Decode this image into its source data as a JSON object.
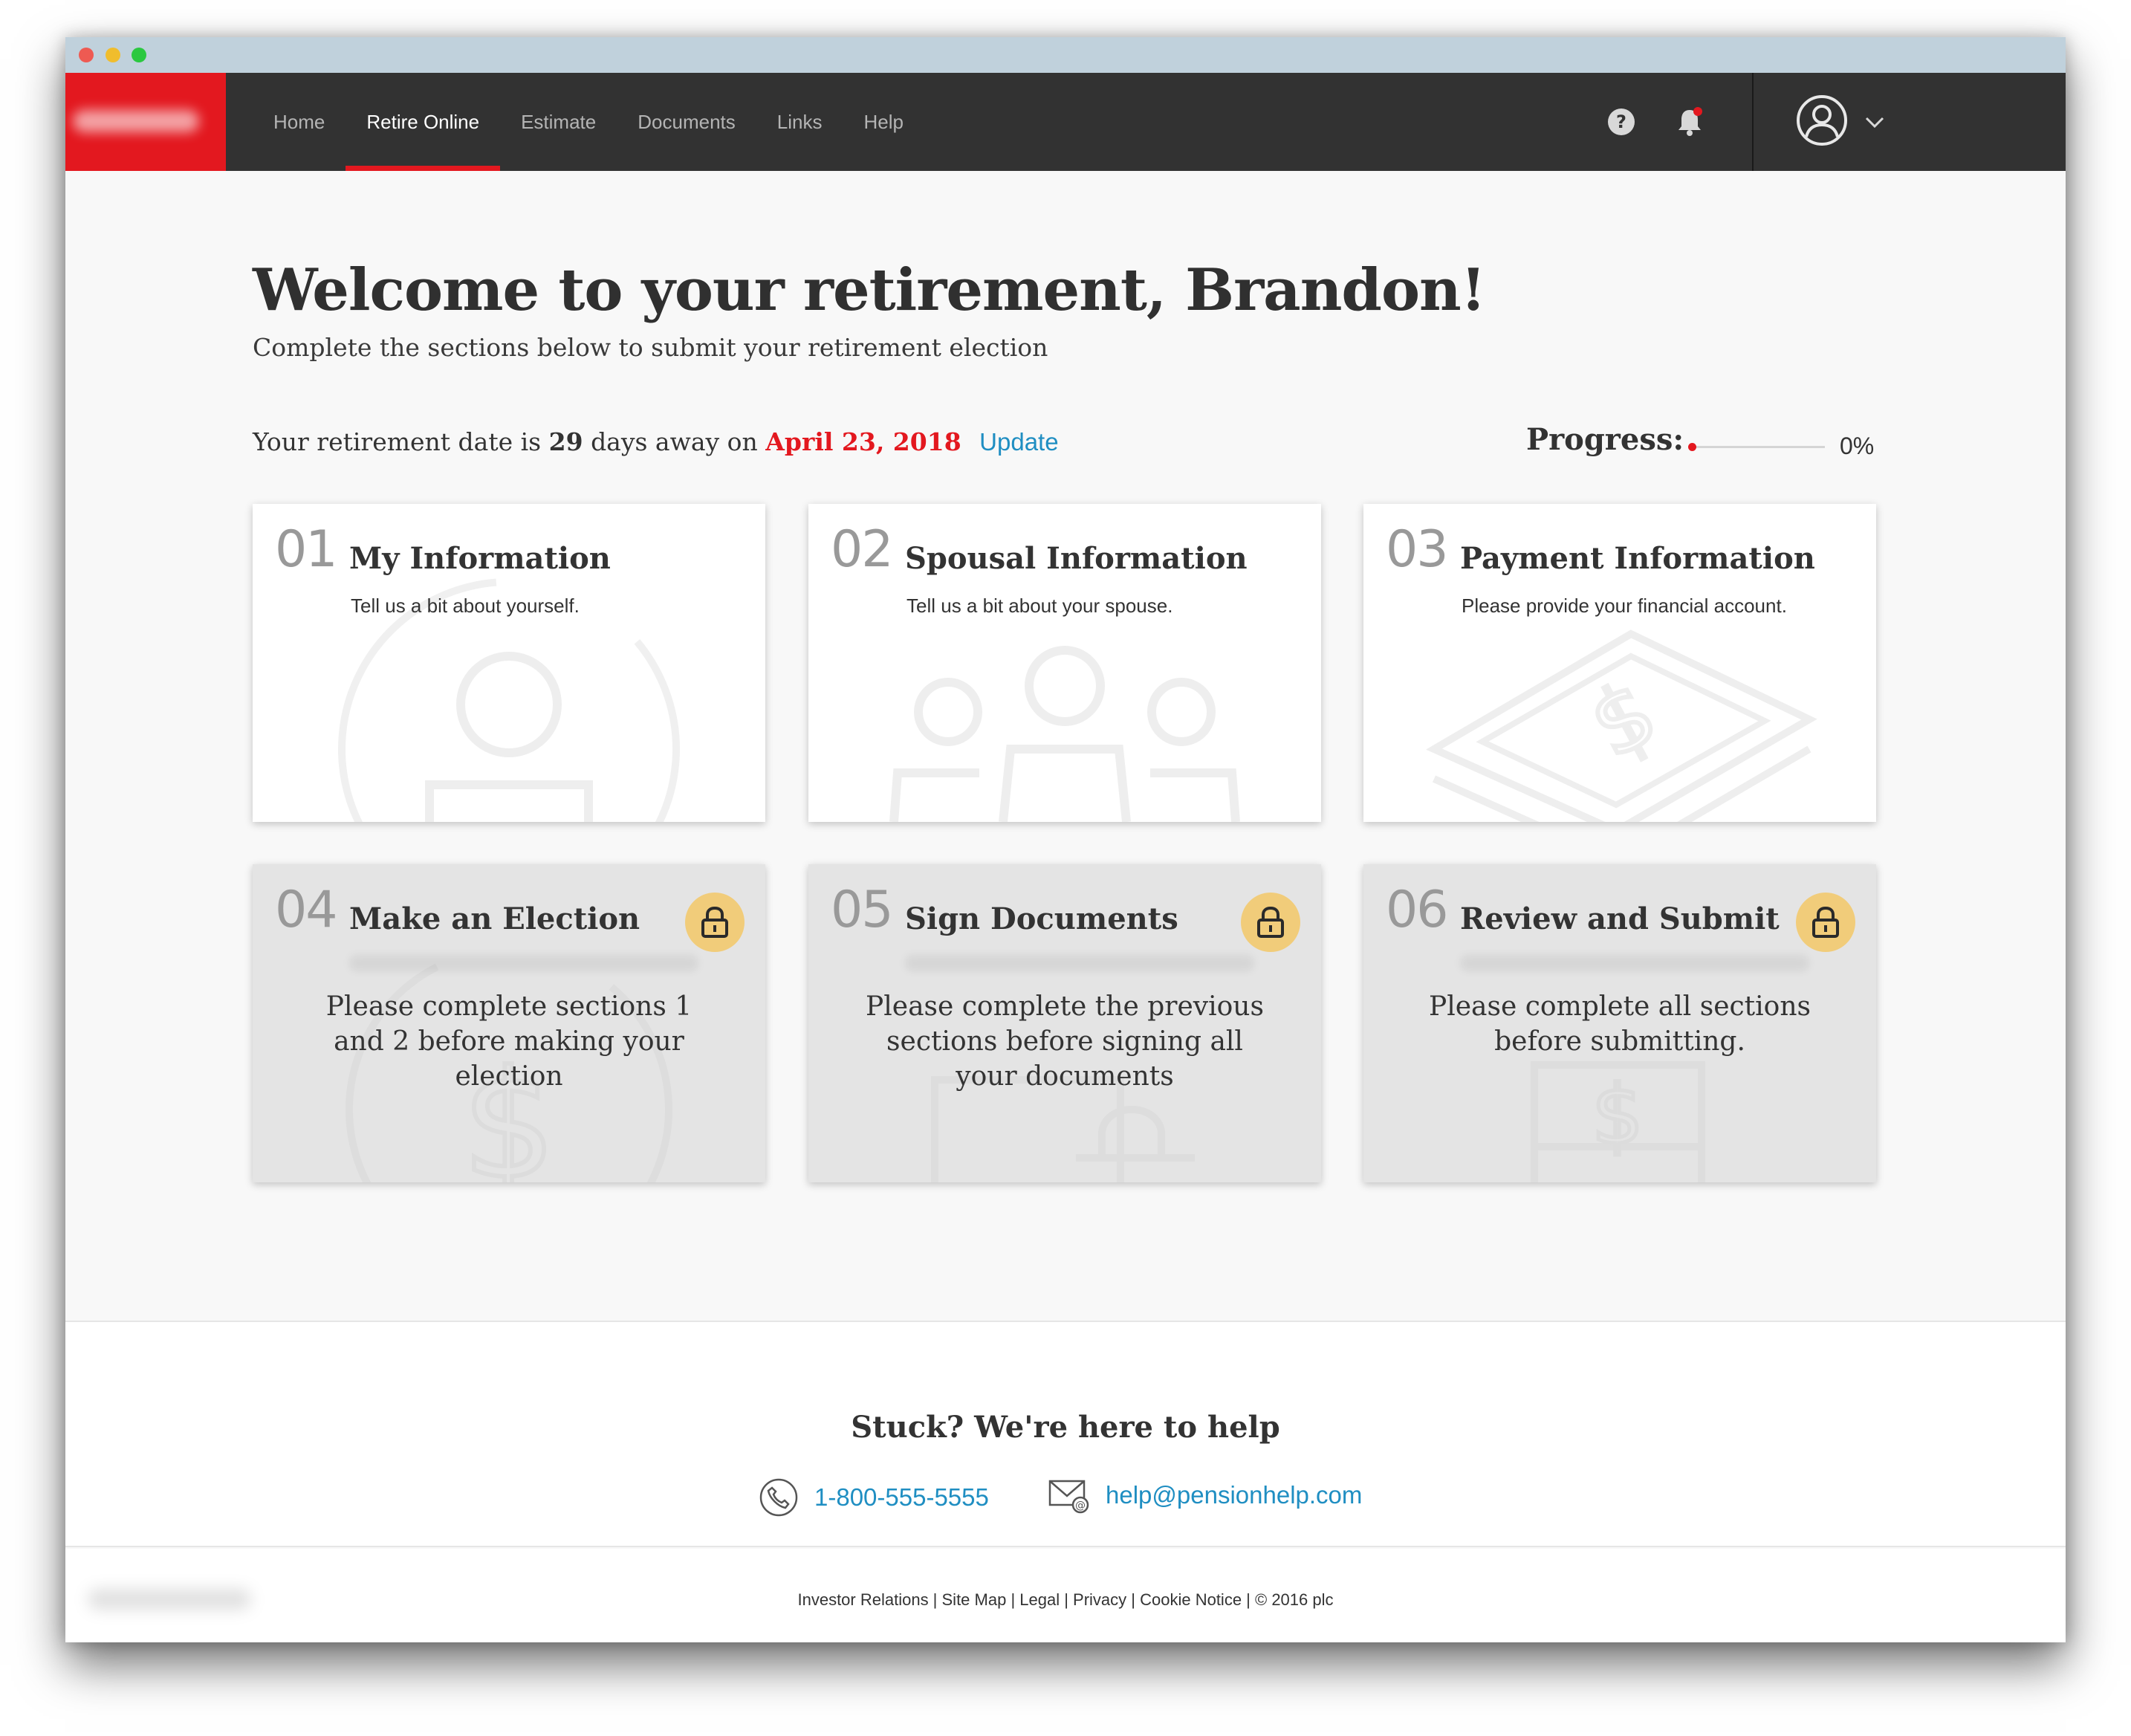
{
  "nav": {
    "items": [
      {
        "label": "Home",
        "active": false
      },
      {
        "label": "Retire Online",
        "active": true
      },
      {
        "label": "Estimate",
        "active": false
      },
      {
        "label": "Documents",
        "active": false
      },
      {
        "label": "Links",
        "active": false
      },
      {
        "label": "Help",
        "active": false
      }
    ],
    "icons": [
      "help-icon",
      "notification-bell-icon",
      "user-avatar-icon",
      "chevron-down-icon"
    ],
    "brand_color": "#e3181f",
    "bar_color": "#323232"
  },
  "header": {
    "title": "Welcome to your retirement, Brandon!",
    "subtitle": "Complete the sections below to submit your retirement election"
  },
  "status": {
    "prefix": "Your retirement date is",
    "days": "29",
    "middle": "days away on",
    "date": "April 23, 2018",
    "update_label": "Update"
  },
  "progress": {
    "label": "Progress:",
    "percent_text": "0%",
    "value": 0
  },
  "cards": [
    {
      "number": "01",
      "title": "My Information",
      "description": "Tell us a bit about yourself.",
      "locked": false,
      "icon": "person-icon"
    },
    {
      "number": "02",
      "title": "Spousal Information",
      "description": "Tell us a bit about your spouse.",
      "locked": false,
      "icon": "family-icon"
    },
    {
      "number": "03",
      "title": "Payment Information",
      "description": "Please provide your financial account.",
      "locked": false,
      "icon": "money-stack-icon"
    },
    {
      "number": "04",
      "title": "Make an Election",
      "locked": true,
      "lock_message": "Please complete sections 1 and 2 before making your election",
      "icon": "dollar-icon"
    },
    {
      "number": "05",
      "title": "Sign Documents",
      "locked": true,
      "lock_message": "Please complete the previous sections before signing all your documents",
      "icon": "document-sign-icon"
    },
    {
      "number": "06",
      "title": "Review and Submit",
      "locked": true,
      "lock_message": "Please complete all sections before submitting.",
      "icon": "submit-icon"
    }
  ],
  "help": {
    "title": "Stuck? We're here to help",
    "phone": "1-800-555-5555",
    "email": "help@pensionhelp.com"
  },
  "footer": {
    "links": "Investor Relations | Site Map | Legal | Privacy | Cookie Notice | © 2016 plc"
  },
  "colors": {
    "accent_link": "#1f8ec2",
    "lock_badge": "#f1cc7a",
    "locked_card_bg": "#e4e4e4"
  }
}
